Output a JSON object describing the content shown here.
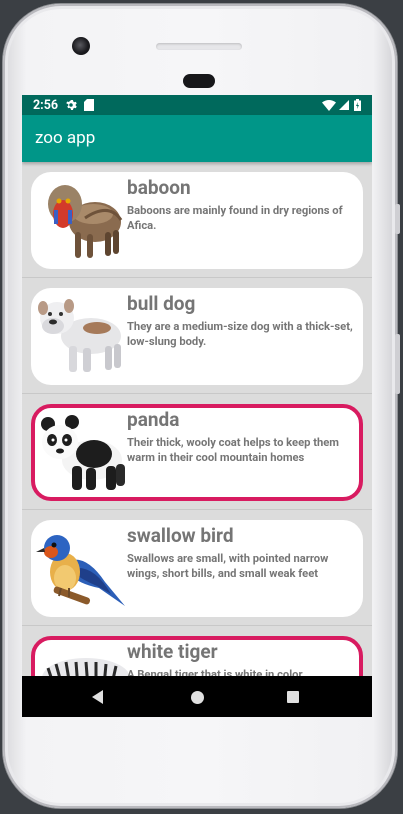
{
  "status_bar": {
    "time": "2:56"
  },
  "app_bar": {
    "title": "zoo app"
  },
  "animals": [
    {
      "name": "baboon",
      "description": "Baboons are mainly found in dry regions of Afica.",
      "highlighted": false
    },
    {
      "name": "bull dog",
      "description": "They are a medium-size dog with a thick-set, low-slung body.",
      "highlighted": false
    },
    {
      "name": "panda",
      "description": "Their thick, wooly coat helps to keep them warm in their cool mountain homes",
      "highlighted": true
    },
    {
      "name": "swallow bird",
      "description": "Swallows are small, with pointed narrow wings, short bills, and small weak feet",
      "highlighted": false
    },
    {
      "name": "white tiger",
      "description": "A Bengal tiger that is white in color",
      "highlighted": true
    }
  ],
  "colors": {
    "primary": "#009688",
    "primary_dark": "#00695c",
    "highlight_border": "#d81b60",
    "text": "#757575"
  },
  "icons": [
    "settings-icon",
    "sd-card-icon",
    "wifi-icon",
    "signal-icon",
    "battery-icon",
    "back-icon",
    "home-icon",
    "recents-icon"
  ]
}
